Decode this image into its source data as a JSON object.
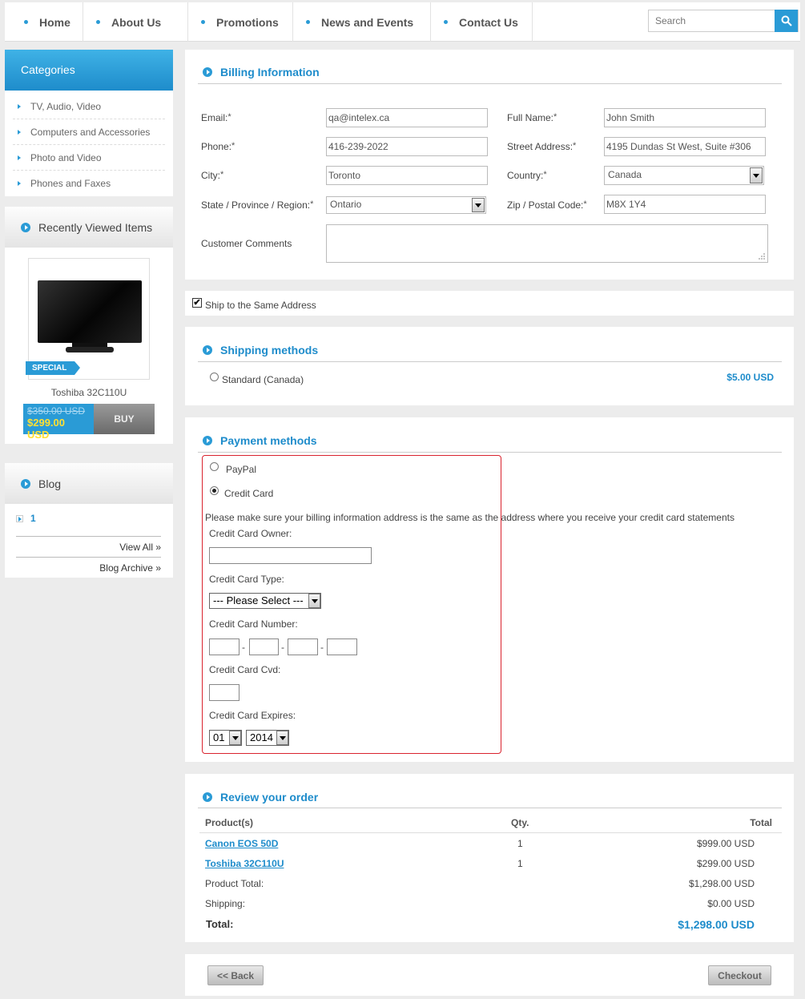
{
  "nav": {
    "items": [
      "Home",
      "About Us",
      "Promotions",
      "News and Events",
      "Contact Us"
    ],
    "search_placeholder": "Search"
  },
  "categories": {
    "title": "Categories",
    "items": [
      "TV, Audio, Video",
      "Computers and Accessories",
      "Photo and Video",
      "Phones and Faxes"
    ]
  },
  "recent": {
    "title": "Recently Viewed Items",
    "badge": "SPECIAL",
    "product_name": "Toshiba 32C110U",
    "old_price": "$350.00 USD",
    "new_price": "$299.00 USD",
    "buy_label": "BUY"
  },
  "blog": {
    "title": "Blog",
    "item": "1",
    "view_all": "View All »",
    "archive": "Blog Archive »"
  },
  "billing": {
    "title": "Billing Information",
    "email_label": "Email:",
    "email_value": "qa@intelex.ca",
    "fullname_label": "Full Name:",
    "fullname_value": "John Smith",
    "phone_label": "Phone:",
    "phone_value": "416-239-2022",
    "street_label": "Street Address:",
    "street_value": "4195 Dundas St West, Suite #306",
    "city_label": "City:",
    "city_value": "Toronto",
    "country_label": "Country:",
    "country_value": "Canada",
    "state_label": "State / Province / Region:",
    "state_value": "Ontario",
    "zip_label": "Zip / Postal Code:",
    "zip_value": "M8X 1Y4",
    "comments_label": "Customer Comments",
    "required_mark": "*"
  },
  "ship_same": {
    "label": "Ship to the Same Address",
    "checked_mark": "✔"
  },
  "shipping": {
    "title": "Shipping methods",
    "option": "Standard (Canada)",
    "price": "$5.00 USD"
  },
  "payment": {
    "title": "Payment methods",
    "paypal": "PayPal",
    "credit_card": "Credit Card",
    "notice": "Please make sure your billing information address is the same as the address where you receive your credit card statements",
    "owner_label": "Credit Card Owner:",
    "type_label": "Credit Card Type:",
    "type_value": "--- Please Select ---",
    "number_label": "Credit Card Number:",
    "number_sep": "-",
    "cvd_label": "Credit Card Cvd:",
    "expires_label": "Credit Card Expires:",
    "month_value": "01",
    "year_value": "2014"
  },
  "review": {
    "title": "Review your order",
    "headers": {
      "product": "Product(s)",
      "qty": "Qty.",
      "total": "Total"
    },
    "rows": [
      {
        "product": "Canon EOS 50D",
        "qty": "1",
        "total": "$999.00 USD"
      },
      {
        "product": "Toshiba 32C110U",
        "qty": "1",
        "total": "$299.00 USD"
      }
    ],
    "product_total_label": "Product Total:",
    "product_total_value": "$1,298.00 USD",
    "shipping_label": "Shipping:",
    "shipping_value": "$0.00 USD",
    "total_label": "Total:",
    "total_value": "$1,298.00 USD"
  },
  "actions": {
    "back": "<< Back",
    "checkout": "Checkout"
  },
  "colors": {
    "accent": "#2a9bd6",
    "title_blue": "#1e8ccb",
    "price_yellow": "#ffe033",
    "error_red": "#d9232e"
  }
}
